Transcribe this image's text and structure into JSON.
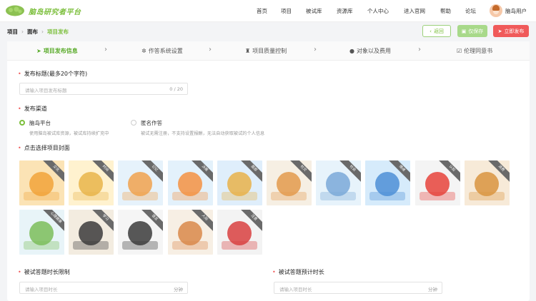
{
  "app": {
    "name": "脑岛研究者平台"
  },
  "nav": {
    "items": [
      "首页",
      "项目",
      "被试库",
      "资源库",
      "个人中心",
      "进入官网",
      "帮助",
      "论坛"
    ],
    "user_name": "脑岛用户"
  },
  "breadcrumb": {
    "items": [
      "项目",
      "面布",
      "项目发布"
    ]
  },
  "actions": {
    "back": "返回",
    "save": "仅保存",
    "publish": "立即发布"
  },
  "steps": [
    "项目发布信息",
    "作答系统设置",
    "项目质量控制",
    "对象以及费用",
    "伦理同意书"
  ],
  "form": {
    "title_label": "发布标题(最多20个字符)",
    "title_placeholder": "请输入项目发布标题",
    "title_counter": "0 / 20",
    "channel_label": "发布渠道",
    "channel_options": [
      {
        "title": "脑岛平台",
        "desc": "使用脑岛被试库资源，被试库持续扩充中",
        "selected": true
      },
      {
        "title": "匿名作答",
        "desc": "被试无需注册，不支持设置报酬，无法自动获取被试的个人信息",
        "selected": false
      }
    ],
    "cover_label": "点击选择项目封面",
    "covers": [
      {
        "tag": "文化"
      },
      {
        "tag": "时间"
      },
      {
        "tag": "记忆"
      },
      {
        "tag": "决策"
      },
      {
        "tag": "面部"
      },
      {
        "tag": "社交"
      },
      {
        "tag": "社会"
      },
      {
        "tag": "情绪"
      },
      {
        "tag": "认知"
      },
      {
        "tag": "消费"
      },
      {
        "tag": "心理健康"
      },
      {
        "tag": "学习"
      },
      {
        "tag": "语言"
      },
      {
        "tag": "人际"
      },
      {
        "tag": "注意"
      }
    ],
    "limit_label": "被试答题时长限制",
    "limit_placeholder": "请输入项目时长",
    "limit_unit": "分钟",
    "estimate_label": "被试答题预计时长",
    "estimate_placeholder": "请输入项目时长",
    "estimate_unit": "分钟"
  },
  "colors": {
    "brand": "#7cbf3c",
    "danger": "#f05a5a",
    "active_step": "#5aab2a"
  },
  "icons": {
    "step_active": "paper-plane-icon",
    "step2": "gear-icon",
    "step3": "quality-icon",
    "step4": "user-icon",
    "step5": "document-icon"
  }
}
